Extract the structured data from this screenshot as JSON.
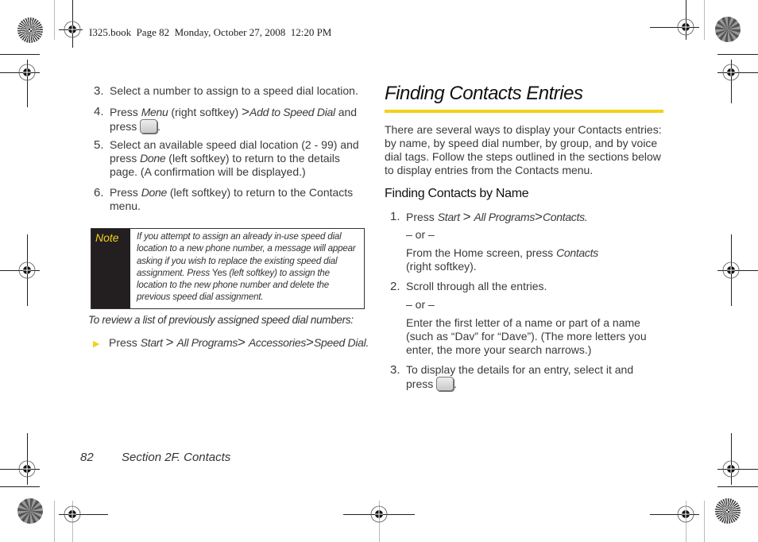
{
  "print_header": "I325.book  Page 82  Monday, October 27, 2008  12:20 PM",
  "left_column": {
    "steps": [
      {
        "num": "3.",
        "parts": [
          "Select a number to assign to a speed dial location."
        ]
      },
      {
        "num": "4.",
        "press": "Press",
        "menu": "Menu",
        "after_menu": "(right softkey)",
        "sep": ">",
        "target": "Add to Speed Dial",
        "and": "and",
        "press2": "press",
        "end": "."
      },
      {
        "num": "5.",
        "line1": "Select an available speed dial location (2 - 99) and",
        "press": "press",
        "done": "Done",
        "rest": "(left softkey) to return to the details page. (A confirmation will be displayed.)"
      },
      {
        "num": "6.",
        "press": "Press",
        "done": "Done",
        "rest": "(left softkey) to return to the Contacts menu."
      }
    ],
    "note": {
      "label": "Note",
      "text_a": "If you attempt to assign an already in-use speed dial location to a new phone number, a message will appear asking if you wish to replace the existing speed dial assignment. Press ",
      "yes": "Yes",
      "text_b": " (left softkey) to assign the location to the new phone number and delete the previous speed dial assignment."
    },
    "review_intro": "To review a list of previously assigned speed dial numbers:",
    "review_step": {
      "press": "Press",
      "path": [
        "Start",
        "All Programs",
        "Accessories",
        "Speed Dial."
      ],
      "sep": ">"
    }
  },
  "right_column": {
    "title": "Finding Contacts Entries",
    "accent_color": "#f1d21b",
    "intro": "There are several ways to display your Contacts entries: by name, by speed dial number, by group, and by voice dial tags. Follow the steps outlined in the sections below to display entries from the Contacts menu.",
    "subheading": "Finding Contacts by Name",
    "steps": [
      {
        "num": "1.",
        "press": "Press",
        "path": [
          "Start",
          "All Programs",
          "Contacts."
        ],
        "sep": ">",
        "or": "– or –",
        "alt_a": "From the Home screen, press ",
        "alt_key": "Contacts",
        "alt_b": "(right softkey)."
      },
      {
        "num": "2.",
        "text": "Scroll through all the entries.",
        "or": "– or –",
        "alt": "Enter the first letter of a name or part of a name (such as “Dav” for “Dave”). (The more letters you enter, the more your search narrows.)"
      },
      {
        "num": "3.",
        "text": "To display the details for an entry, select it and",
        "press": "press",
        "end": "."
      }
    ]
  },
  "footer": {
    "page_number": "82",
    "section": "Section 2F. Contacts"
  }
}
